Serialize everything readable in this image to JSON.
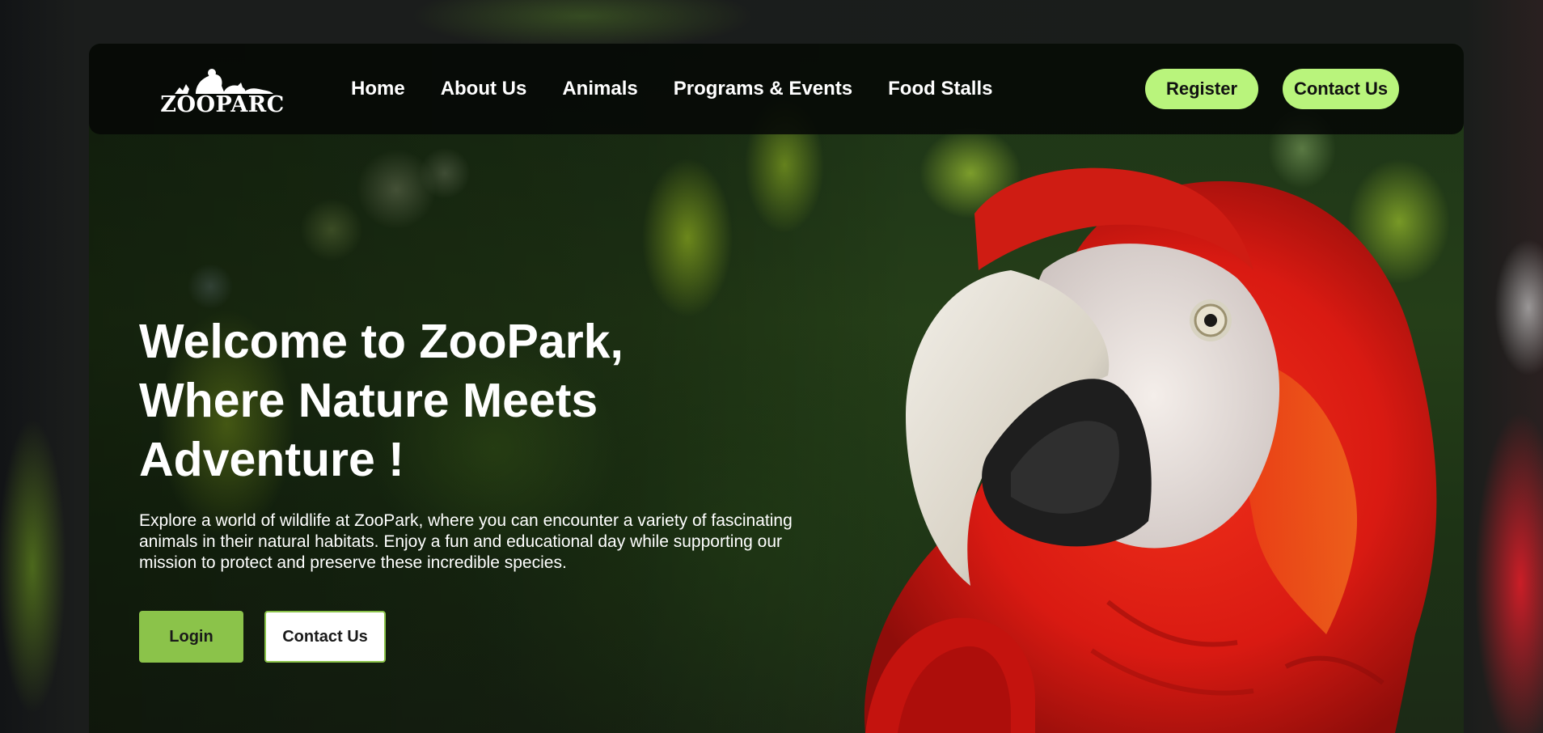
{
  "brand": {
    "logo_text": "ZOOPARC",
    "logo_icon": "zoo-animals-silhouette-icon"
  },
  "nav": {
    "links": [
      "Home",
      "About Us",
      "Animals",
      "Programs & Events",
      "Food Stalls"
    ],
    "register_label": "Register",
    "contact_label": "Contact Us",
    "accent_color": "#b9f47c"
  },
  "hero": {
    "title": "Welcome to ZooPark, Where Nature Meets Adventure !",
    "description": "Explore a world of wildlife at ZooPark, where you can encounter a variety of fascinating animals in their natural habitats. Enjoy a fun and educational day while supporting our mission to protect and preserve these incredible species.",
    "login_label": "Login",
    "contact_label": "Contact Us",
    "login_color": "#8bc34a",
    "image": "scarlet-macaw-parrot-photo"
  }
}
